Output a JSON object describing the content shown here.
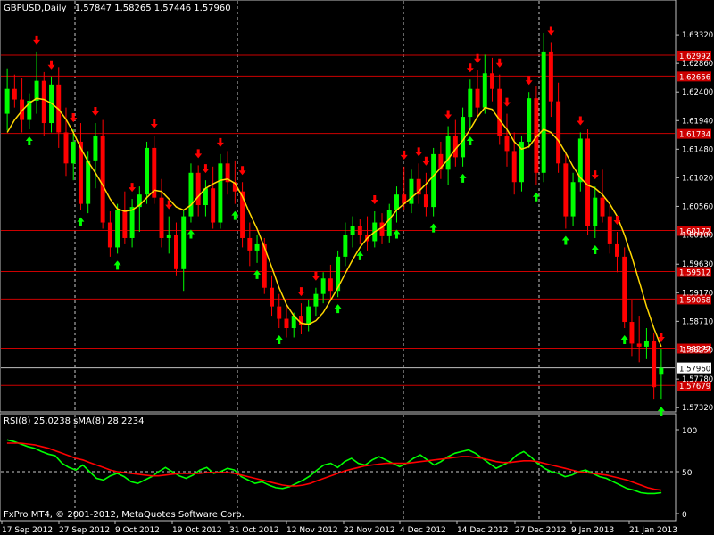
{
  "chart_data": [
    {
      "type": "candlestick",
      "header": {
        "symbol": "GBPUSD,Daily",
        "quote": "1.57847 1.58265 1.57446 1.57960"
      },
      "ylim": [
        1.5728,
        1.6368
      ],
      "y_ticks": [
        "1.63320",
        "1.62860",
        "1.62400",
        "1.61940",
        "1.61480",
        "1.61020",
        "1.60560",
        "1.60100",
        "1.59630",
        "1.59170",
        "1.58710",
        "1.58250",
        "1.57780",
        "1.57320"
      ],
      "x_ticks": [
        "17 Sep 2012",
        "27 Sep 2012",
        "9 Oct 2012",
        "19 Oct 2012",
        "31 Oct 2012",
        "12 Nov 2012",
        "22 Nov 2012",
        "4 Dec 2012",
        "14 Dec 2012",
        "27 Dec 2012",
        "9 Jan 2013",
        "21 Jan 2013"
      ],
      "current_price_label": "1.57960",
      "current_price": 1.5796,
      "resistance_lines": [
        {
          "label": "1.62992",
          "value": 1.62992
        },
        {
          "label": "1.62656",
          "value": 1.62656
        },
        {
          "label": "1.61734",
          "value": 1.61734
        },
        {
          "label": "1.60172",
          "value": 1.60172
        },
        {
          "label": "1.59512",
          "value": 1.59512
        },
        {
          "label": "1.59068",
          "value": 1.59068
        },
        {
          "label": "1.58277",
          "value": 1.58277
        },
        {
          "label": "1.57679",
          "value": 1.57679
        }
      ],
      "candles": [
        {
          "o": 1.6205,
          "h": 1.6278,
          "l": 1.6178,
          "c": 1.6245
        },
        {
          "o": 1.6245,
          "h": 1.6268,
          "l": 1.6215,
          "c": 1.6228
        },
        {
          "o": 1.6228,
          "h": 1.6262,
          "l": 1.6175,
          "c": 1.6195
        },
        {
          "o": 1.6195,
          "h": 1.6238,
          "l": 1.618,
          "c": 1.6226
        },
        {
          "o": 1.6226,
          "h": 1.6305,
          "l": 1.6205,
          "c": 1.6258
        },
        {
          "o": 1.6258,
          "h": 1.6272,
          "l": 1.617,
          "c": 1.619
        },
        {
          "o": 1.619,
          "h": 1.6265,
          "l": 1.6175,
          "c": 1.6252
        },
        {
          "o": 1.6252,
          "h": 1.628,
          "l": 1.615,
          "c": 1.6175
        },
        {
          "o": 1.6175,
          "h": 1.6215,
          "l": 1.6105,
          "c": 1.6125
        },
        {
          "o": 1.6125,
          "h": 1.618,
          "l": 1.6098,
          "c": 1.616
        },
        {
          "o": 1.616,
          "h": 1.619,
          "l": 1.605,
          "c": 1.606
        },
        {
          "o": 1.606,
          "h": 1.6145,
          "l": 1.6045,
          "c": 1.613
        },
        {
          "o": 1.613,
          "h": 1.619,
          "l": 1.6085,
          "c": 1.617
        },
        {
          "o": 1.617,
          "h": 1.6195,
          "l": 1.602,
          "c": 1.603
        },
        {
          "o": 1.603,
          "h": 1.6048,
          "l": 1.5975,
          "c": 1.599
        },
        {
          "o": 1.599,
          "h": 1.606,
          "l": 1.598,
          "c": 1.605
        },
        {
          "o": 1.605,
          "h": 1.608,
          "l": 1.5995,
          "c": 1.6005
        },
        {
          "o": 1.6005,
          "h": 1.6068,
          "l": 1.599,
          "c": 1.6055
        },
        {
          "o": 1.6055,
          "h": 1.6088,
          "l": 1.6015,
          "c": 1.6075
        },
        {
          "o": 1.6075,
          "h": 1.616,
          "l": 1.606,
          "c": 1.615
        },
        {
          "o": 1.615,
          "h": 1.617,
          "l": 1.606,
          "c": 1.607
        },
        {
          "o": 1.607,
          "h": 1.61,
          "l": 1.599,
          "c": 1.6005
        },
        {
          "o": 1.6005,
          "h": 1.604,
          "l": 1.598,
          "c": 1.601
        },
        {
          "o": 1.601,
          "h": 1.603,
          "l": 1.5945,
          "c": 1.5955
        },
        {
          "o": 1.5955,
          "h": 1.605,
          "l": 1.592,
          "c": 1.604
        },
        {
          "o": 1.604,
          "h": 1.6125,
          "l": 1.603,
          "c": 1.611
        },
        {
          "o": 1.611,
          "h": 1.6122,
          "l": 1.604,
          "c": 1.6058
        },
        {
          "o": 1.6058,
          "h": 1.6098,
          "l": 1.604,
          "c": 1.6085
        },
        {
          "o": 1.6085,
          "h": 1.612,
          "l": 1.602,
          "c": 1.603
        },
        {
          "o": 1.603,
          "h": 1.614,
          "l": 1.602,
          "c": 1.6125
        },
        {
          "o": 1.6125,
          "h": 1.6145,
          "l": 1.6075,
          "c": 1.6095
        },
        {
          "o": 1.6095,
          "h": 1.613,
          "l": 1.606,
          "c": 1.608
        },
        {
          "o": 1.608,
          "h": 1.6095,
          "l": 1.599,
          "c": 1.6005
        },
        {
          "o": 1.6005,
          "h": 1.603,
          "l": 1.596,
          "c": 1.5985
        },
        {
          "o": 1.5985,
          "h": 1.601,
          "l": 1.5965,
          "c": 1.5995
        },
        {
          "o": 1.5995,
          "h": 1.6005,
          "l": 1.5915,
          "c": 1.5925
        },
        {
          "o": 1.5925,
          "h": 1.5945,
          "l": 1.588,
          "c": 1.5895
        },
        {
          "o": 1.5895,
          "h": 1.5915,
          "l": 1.586,
          "c": 1.5875
        },
        {
          "o": 1.5875,
          "h": 1.5895,
          "l": 1.5845,
          "c": 1.586
        },
        {
          "o": 1.586,
          "h": 1.5885,
          "l": 1.5845,
          "c": 1.588
        },
        {
          "o": 1.588,
          "h": 1.59,
          "l": 1.585,
          "c": 1.5865
        },
        {
          "o": 1.5865,
          "h": 1.5905,
          "l": 1.5855,
          "c": 1.5895
        },
        {
          "o": 1.5895,
          "h": 1.5925,
          "l": 1.588,
          "c": 1.5915
        },
        {
          "o": 1.5915,
          "h": 1.595,
          "l": 1.59,
          "c": 1.594
        },
        {
          "o": 1.594,
          "h": 1.5962,
          "l": 1.5905,
          "c": 1.592
        },
        {
          "o": 1.592,
          "h": 1.5985,
          "l": 1.591,
          "c": 1.5975
        },
        {
          "o": 1.5975,
          "h": 1.603,
          "l": 1.596,
          "c": 1.601
        },
        {
          "o": 1.601,
          "h": 1.604,
          "l": 1.599,
          "c": 1.6025
        },
        {
          "o": 1.6025,
          "h": 1.6035,
          "l": 1.5995,
          "c": 1.601
        },
        {
          "o": 1.601,
          "h": 1.604,
          "l": 1.5985,
          "c": 1.6
        },
        {
          "o": 1.6,
          "h": 1.6048,
          "l": 1.599,
          "c": 1.603
        },
        {
          "o": 1.603,
          "h": 1.6045,
          "l": 1.5995,
          "c": 1.6008
        },
        {
          "o": 1.6008,
          "h": 1.606,
          "l": 1.5998,
          "c": 1.605
        },
        {
          "o": 1.605,
          "h": 1.6088,
          "l": 1.603,
          "c": 1.6075
        },
        {
          "o": 1.6075,
          "h": 1.612,
          "l": 1.605,
          "c": 1.606
        },
        {
          "o": 1.606,
          "h": 1.6115,
          "l": 1.6045,
          "c": 1.61
        },
        {
          "o": 1.61,
          "h": 1.6125,
          "l": 1.606,
          "c": 1.6075
        },
        {
          "o": 1.6075,
          "h": 1.611,
          "l": 1.604,
          "c": 1.6055
        },
        {
          "o": 1.6055,
          "h": 1.615,
          "l": 1.604,
          "c": 1.614
        },
        {
          "o": 1.614,
          "h": 1.616,
          "l": 1.61,
          "c": 1.6115
        },
        {
          "o": 1.6115,
          "h": 1.6185,
          "l": 1.609,
          "c": 1.617
        },
        {
          "o": 1.617,
          "h": 1.6195,
          "l": 1.612,
          "c": 1.6135
        },
        {
          "o": 1.6135,
          "h": 1.6215,
          "l": 1.612,
          "c": 1.62
        },
        {
          "o": 1.62,
          "h": 1.626,
          "l": 1.618,
          "c": 1.6245
        },
        {
          "o": 1.6245,
          "h": 1.6275,
          "l": 1.62,
          "c": 1.6215
        },
        {
          "o": 1.6215,
          "h": 1.63,
          "l": 1.6205,
          "c": 1.627
        },
        {
          "o": 1.627,
          "h": 1.6295,
          "l": 1.6225,
          "c": 1.6245
        },
        {
          "o": 1.6245,
          "h": 1.6268,
          "l": 1.6155,
          "c": 1.617
        },
        {
          "o": 1.617,
          "h": 1.6205,
          "l": 1.612,
          "c": 1.6145
        },
        {
          "o": 1.6145,
          "h": 1.6175,
          "l": 1.6075,
          "c": 1.6095
        },
        {
          "o": 1.6095,
          "h": 1.617,
          "l": 1.608,
          "c": 1.616
        },
        {
          "o": 1.616,
          "h": 1.624,
          "l": 1.615,
          "c": 1.623
        },
        {
          "o": 1.623,
          "h": 1.625,
          "l": 1.609,
          "c": 1.611
        },
        {
          "o": 1.611,
          "h": 1.6335,
          "l": 1.6095,
          "c": 1.6305
        },
        {
          "o": 1.6305,
          "h": 1.632,
          "l": 1.62,
          "c": 1.6225
        },
        {
          "o": 1.6225,
          "h": 1.6255,
          "l": 1.611,
          "c": 1.6125
        },
        {
          "o": 1.6125,
          "h": 1.614,
          "l": 1.602,
          "c": 1.604
        },
        {
          "o": 1.604,
          "h": 1.611,
          "l": 1.6025,
          "c": 1.6095
        },
        {
          "o": 1.6095,
          "h": 1.6175,
          "l": 1.608,
          "c": 1.6165
        },
        {
          "o": 1.6165,
          "h": 1.618,
          "l": 1.601,
          "c": 1.6025
        },
        {
          "o": 1.6025,
          "h": 1.6088,
          "l": 1.6005,
          "c": 1.607
        },
        {
          "o": 1.607,
          "h": 1.6115,
          "l": 1.603,
          "c": 1.604
        },
        {
          "o": 1.604,
          "h": 1.606,
          "l": 1.598,
          "c": 1.5995
        },
        {
          "o": 1.5995,
          "h": 1.6015,
          "l": 1.595,
          "c": 1.5975
        },
        {
          "o": 1.5975,
          "h": 1.599,
          "l": 1.586,
          "c": 1.587
        },
        {
          "o": 1.587,
          "h": 1.5905,
          "l": 1.5815,
          "c": 1.5835
        },
        {
          "o": 1.5835,
          "h": 1.588,
          "l": 1.5805,
          "c": 1.583
        },
        {
          "o": 1.583,
          "h": 1.586,
          "l": 1.581,
          "c": 1.584
        },
        {
          "o": 1.584,
          "h": 1.5852,
          "l": 1.5745,
          "c": 1.5765
        },
        {
          "o": 1.5785,
          "h": 1.5827,
          "l": 1.5745,
          "c": 1.5796
        }
      ],
      "ma_line": [
        1.6175,
        1.6195,
        1.621,
        1.6222,
        1.623,
        1.6228,
        1.6222,
        1.6212,
        1.6196,
        1.6175,
        1.615,
        1.6128,
        1.611,
        1.609,
        1.6068,
        1.6052,
        1.6048,
        1.605,
        1.6058,
        1.607,
        1.6082,
        1.608,
        1.6068,
        1.6055,
        1.605,
        1.6058,
        1.6072,
        1.6085,
        1.6092,
        1.6098,
        1.61,
        1.6093,
        1.6072,
        1.6045,
        1.602,
        1.599,
        1.5958,
        1.5925,
        1.5898,
        1.588,
        1.5868,
        1.5866,
        1.5872,
        1.5885,
        1.5905,
        1.5925,
        1.5948,
        1.597,
        1.599,
        1.6005,
        1.6015,
        1.6022,
        1.6035,
        1.605,
        1.606,
        1.607,
        1.608,
        1.6092,
        1.6105,
        1.6118,
        1.6132,
        1.6148,
        1.6162,
        1.618,
        1.62,
        1.6215,
        1.6212,
        1.6195,
        1.618,
        1.616,
        1.6148,
        1.6152,
        1.6168,
        1.618,
        1.6175,
        1.6162,
        1.6142,
        1.612,
        1.6102,
        1.609,
        1.6085,
        1.6075,
        1.606,
        1.604,
        1.601,
        1.5975,
        1.5935,
        1.5895,
        1.586,
        1.583
      ],
      "buy_arrows": [
        3,
        10,
        15,
        25,
        31,
        34,
        37,
        45,
        48,
        53,
        58,
        62,
        63,
        72,
        76,
        80,
        84,
        89
      ],
      "sell_arrows": [
        5,
        8,
        11,
        12,
        15,
        22,
        26,
        28,
        33,
        35,
        38,
        41,
        51,
        54,
        65,
        69,
        72,
        74,
        77,
        81,
        83,
        86,
        88,
        92,
        96,
        100,
        103,
        107,
        115
      ]
    },
    {
      "type": "line",
      "legend": "RSI(8) 25.0238   sMA(8) 28.2234",
      "ylim": [
        0,
        100
      ],
      "y_ticks": [
        "100",
        "50",
        "0"
      ],
      "series": [
        {
          "name": "RSI(8)",
          "color": "#00ff00",
          "values": [
            88,
            86,
            83,
            80,
            78,
            74,
            71,
            69,
            60,
            55,
            52,
            58,
            50,
            42,
            40,
            45,
            48,
            44,
            38,
            36,
            40,
            44,
            50,
            55,
            50,
            45,
            42,
            46,
            52,
            55,
            48,
            50,
            54,
            52,
            44,
            40,
            36,
            38,
            34,
            31,
            30,
            32,
            36,
            40,
            45,
            52,
            58,
            60,
            55,
            62,
            66,
            60,
            58,
            64,
            68,
            64,
            60,
            56,
            60,
            66,
            70,
            64,
            58,
            62,
            68,
            72,
            74,
            76,
            72,
            66,
            60,
            54,
            58,
            62,
            70,
            74,
            68,
            60,
            54,
            50,
            48,
            44,
            46,
            50,
            52,
            48,
            44,
            42,
            38,
            34,
            30,
            28,
            25,
            24,
            24,
            25
          ]
        },
        {
          "name": "sMA(8)",
          "color": "#ff0000",
          "values": [
            84,
            84,
            84,
            83,
            82,
            80,
            78,
            75,
            72,
            69,
            66,
            64,
            61,
            58,
            55,
            52,
            50,
            49,
            48,
            47,
            46,
            45,
            45,
            46,
            47,
            48,
            48,
            48,
            48,
            49,
            49,
            49,
            49,
            48,
            46,
            44,
            42,
            40,
            38,
            36,
            34,
            33,
            33,
            34,
            36,
            39,
            42,
            45,
            48,
            51,
            53,
            55,
            57,
            58,
            59,
            60,
            60,
            60,
            60,
            61,
            62,
            63,
            64,
            65,
            66,
            67,
            68,
            68,
            67,
            66,
            64,
            62,
            61,
            61,
            62,
            63,
            63,
            62,
            60,
            58,
            56,
            54,
            52,
            50,
            49,
            48,
            47,
            46,
            44,
            42,
            40,
            37,
            34,
            31,
            29,
            28
          ]
        }
      ]
    }
  ],
  "footer": "FxPro MT4, © 2001-2012, MetaQuotes Software Corp."
}
